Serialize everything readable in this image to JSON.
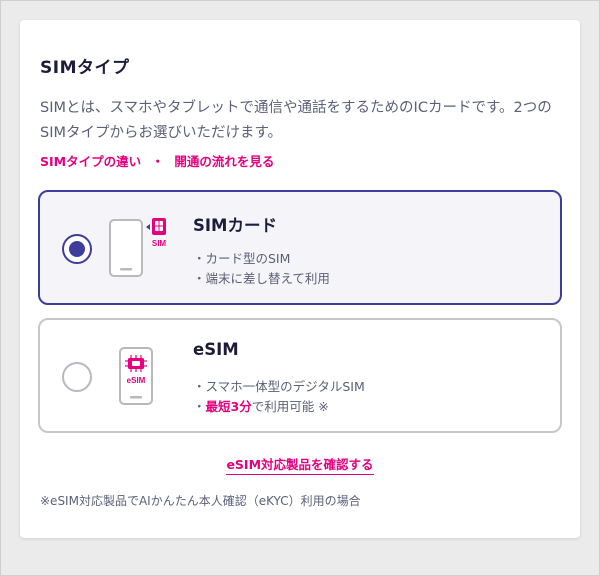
{
  "section": {
    "title": "SIMタイプ",
    "description": "SIMとは、スマホやタブレットで通信や通話をするためのICカードです。2つのSIMタイプからお選びいただけます。",
    "link_difference": "SIMタイプの違い",
    "link_separator": "・",
    "link_flow": "開通の流れを見る"
  },
  "options": [
    {
      "name": "SIMカード",
      "selected": true,
      "icon": "sim-card-icon",
      "icon_label": "SIM",
      "features": [
        "・カード型のSIM",
        "・端末に差し替えて利用"
      ]
    },
    {
      "name": "eSIM",
      "selected": false,
      "icon": "esim-phone-icon",
      "icon_label": "eSIM",
      "features": [
        "・スマホ一体型のデジタルSIM"
      ],
      "feature2_prefix": "・",
      "feature2_highlight": "最短3分",
      "feature2_suffix": "で利用可能 ※"
    }
  ],
  "confirm_link": "eSIM対応製品を確認する",
  "footnote": "※eSIM対応製品でAIかんたん本人確認（eKYC）利用の場合",
  "colors": {
    "accent_pink": "#e5007f",
    "selected_border": "#3f3d9b",
    "text_dark": "#1d1d3b",
    "text_muted": "#5c6078"
  }
}
